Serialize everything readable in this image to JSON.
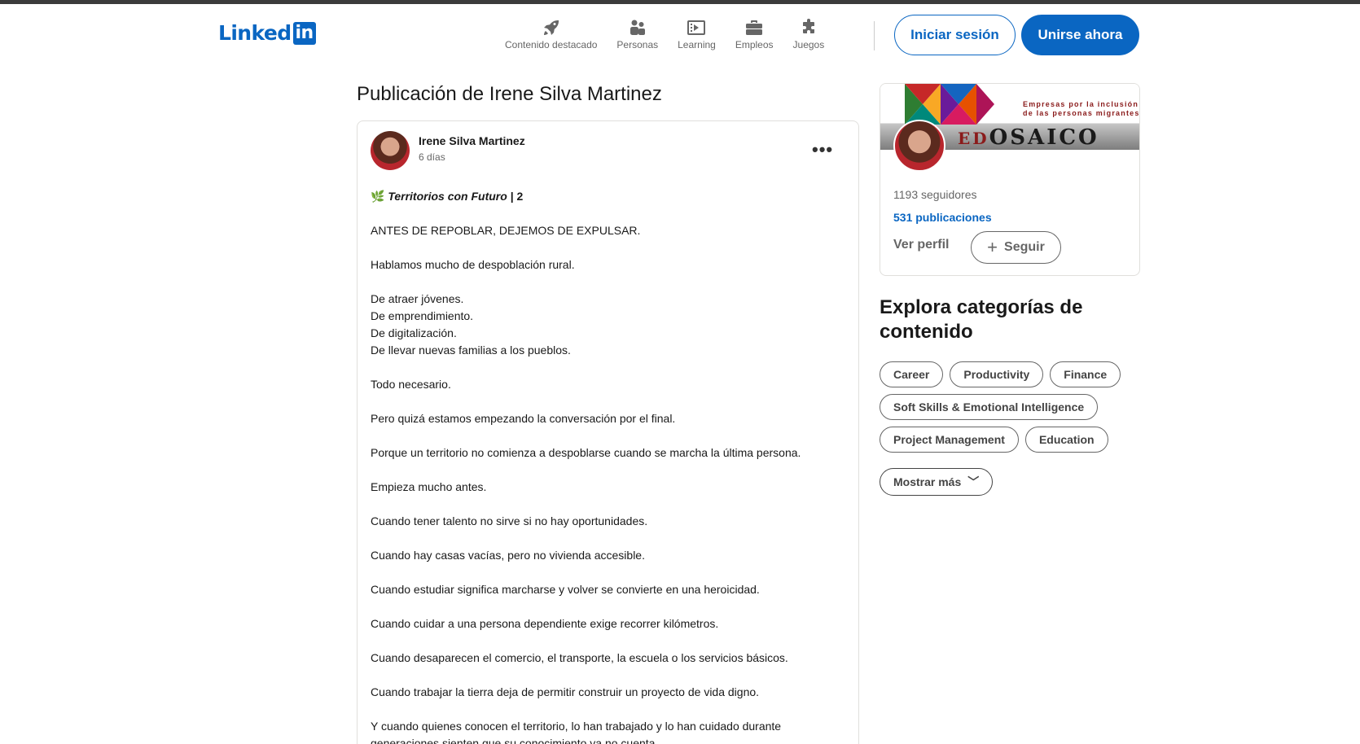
{
  "header": {
    "logo_text": "Linked",
    "logo_in": "in",
    "nav": [
      {
        "label": "Contenido destacado",
        "icon": "rocket-icon"
      },
      {
        "label": "Personas",
        "icon": "people-icon"
      },
      {
        "label": "Learning",
        "icon": "learning-icon"
      },
      {
        "label": "Empleos",
        "icon": "briefcase-icon"
      },
      {
        "label": "Juegos",
        "icon": "puzzle-icon"
      }
    ],
    "signin_label": "Iniciar sesión",
    "join_label": "Unirse ahora"
  },
  "page": {
    "title": "Publicación de Irene Silva Martinez"
  },
  "post": {
    "author": "Irene Silva Martinez",
    "time": "6 días",
    "more_label": "•••",
    "tag_emoji": "🌿",
    "tag_text": "Territorios con Futuro",
    "tag_suffix": " | 2",
    "paragraphs": [
      "ANTES DE REPOBLAR, DEJEMOS DE EXPULSAR.",
      "Hablamos mucho de despoblación rural.",
      "De atraer jóvenes.",
      "De emprendimiento.",
      "De digitalización.",
      "De llevar nuevas familias a los pueblos.",
      "Todo necesario.",
      "Pero quizá estamos empezando la conversación por el final.",
      "Porque un territorio no comienza a despoblarse cuando se marcha la última persona.",
      "Empieza mucho antes.",
      "Cuando tener talento no sirve si no hay oportunidades.",
      "Cuando hay casas vacías, pero no vivienda accesible.",
      "Cuando estudiar significa marcharse y volver se convierte en una heroicidad.",
      "Cuando cuidar a una persona dependiente exige recorrer kilómetros.",
      "Cuando desaparecen el comercio, el transporte, la escuela o los servicios básicos.",
      "Cuando trabajar la tierra deja de permitir construir un proyecto de vida digno.",
      "Y cuando quienes conocen el territorio, lo han trabajado y lo han cuidado durante generaciones sienten que su conocimiento ya no cuenta."
    ]
  },
  "profile_card": {
    "banner_caption_1": "Empresas por la inclusión",
    "banner_caption_2": "de las personas migrantes",
    "banner_ed": "ED",
    "banner_title": "OSAICO",
    "followers": "1193 seguidores",
    "posts": "531 publicaciones",
    "view_profile": "Ver perfil",
    "follow_label": "Seguir",
    "follow_plus": "+"
  },
  "explore": {
    "title": "Explora categorías de contenido",
    "categories": [
      "Career",
      "Productivity",
      "Finance",
      "Soft Skills & Emotional Intelligence",
      "Project Management",
      "Education"
    ],
    "more_label": "Mostrar más",
    "more_chevron": "﹀"
  }
}
